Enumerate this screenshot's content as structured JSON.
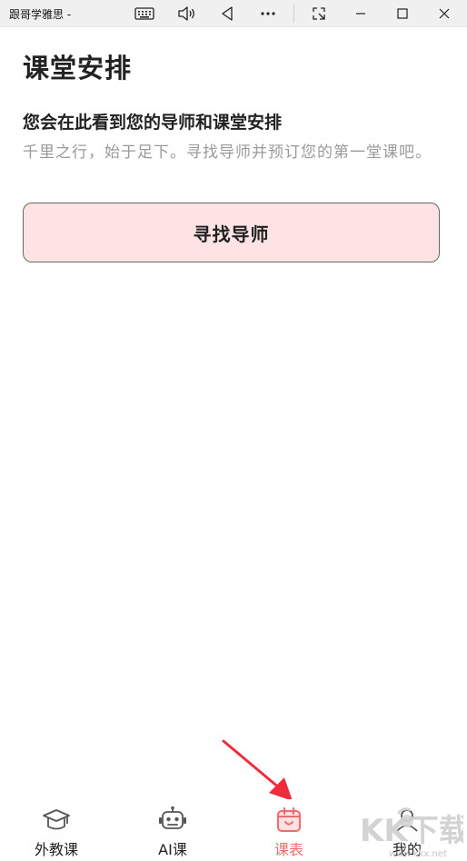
{
  "window": {
    "title": "跟哥学雅思 -"
  },
  "page": {
    "title": "课堂安排",
    "heading": "您会在此看到您的导师和课堂安排",
    "description": "千里之行，始于足下。寻找导师并预订您的第一堂课吧。",
    "find_button": "寻找导师"
  },
  "nav": {
    "items": [
      {
        "label": "外教课",
        "icon": "graduation-cap-icon",
        "active": false
      },
      {
        "label": "AI课",
        "icon": "robot-icon",
        "active": false
      },
      {
        "label": "课表",
        "icon": "calendar-icon",
        "active": true
      },
      {
        "label": "我的",
        "icon": "user-icon",
        "active": false
      }
    ]
  },
  "watermark": {
    "text": "KK下载",
    "url": "www.kkx.net"
  },
  "colors": {
    "accent": "#f26b6b",
    "button_bg": "#fde3e4",
    "arrow": "#ee2d3c"
  }
}
